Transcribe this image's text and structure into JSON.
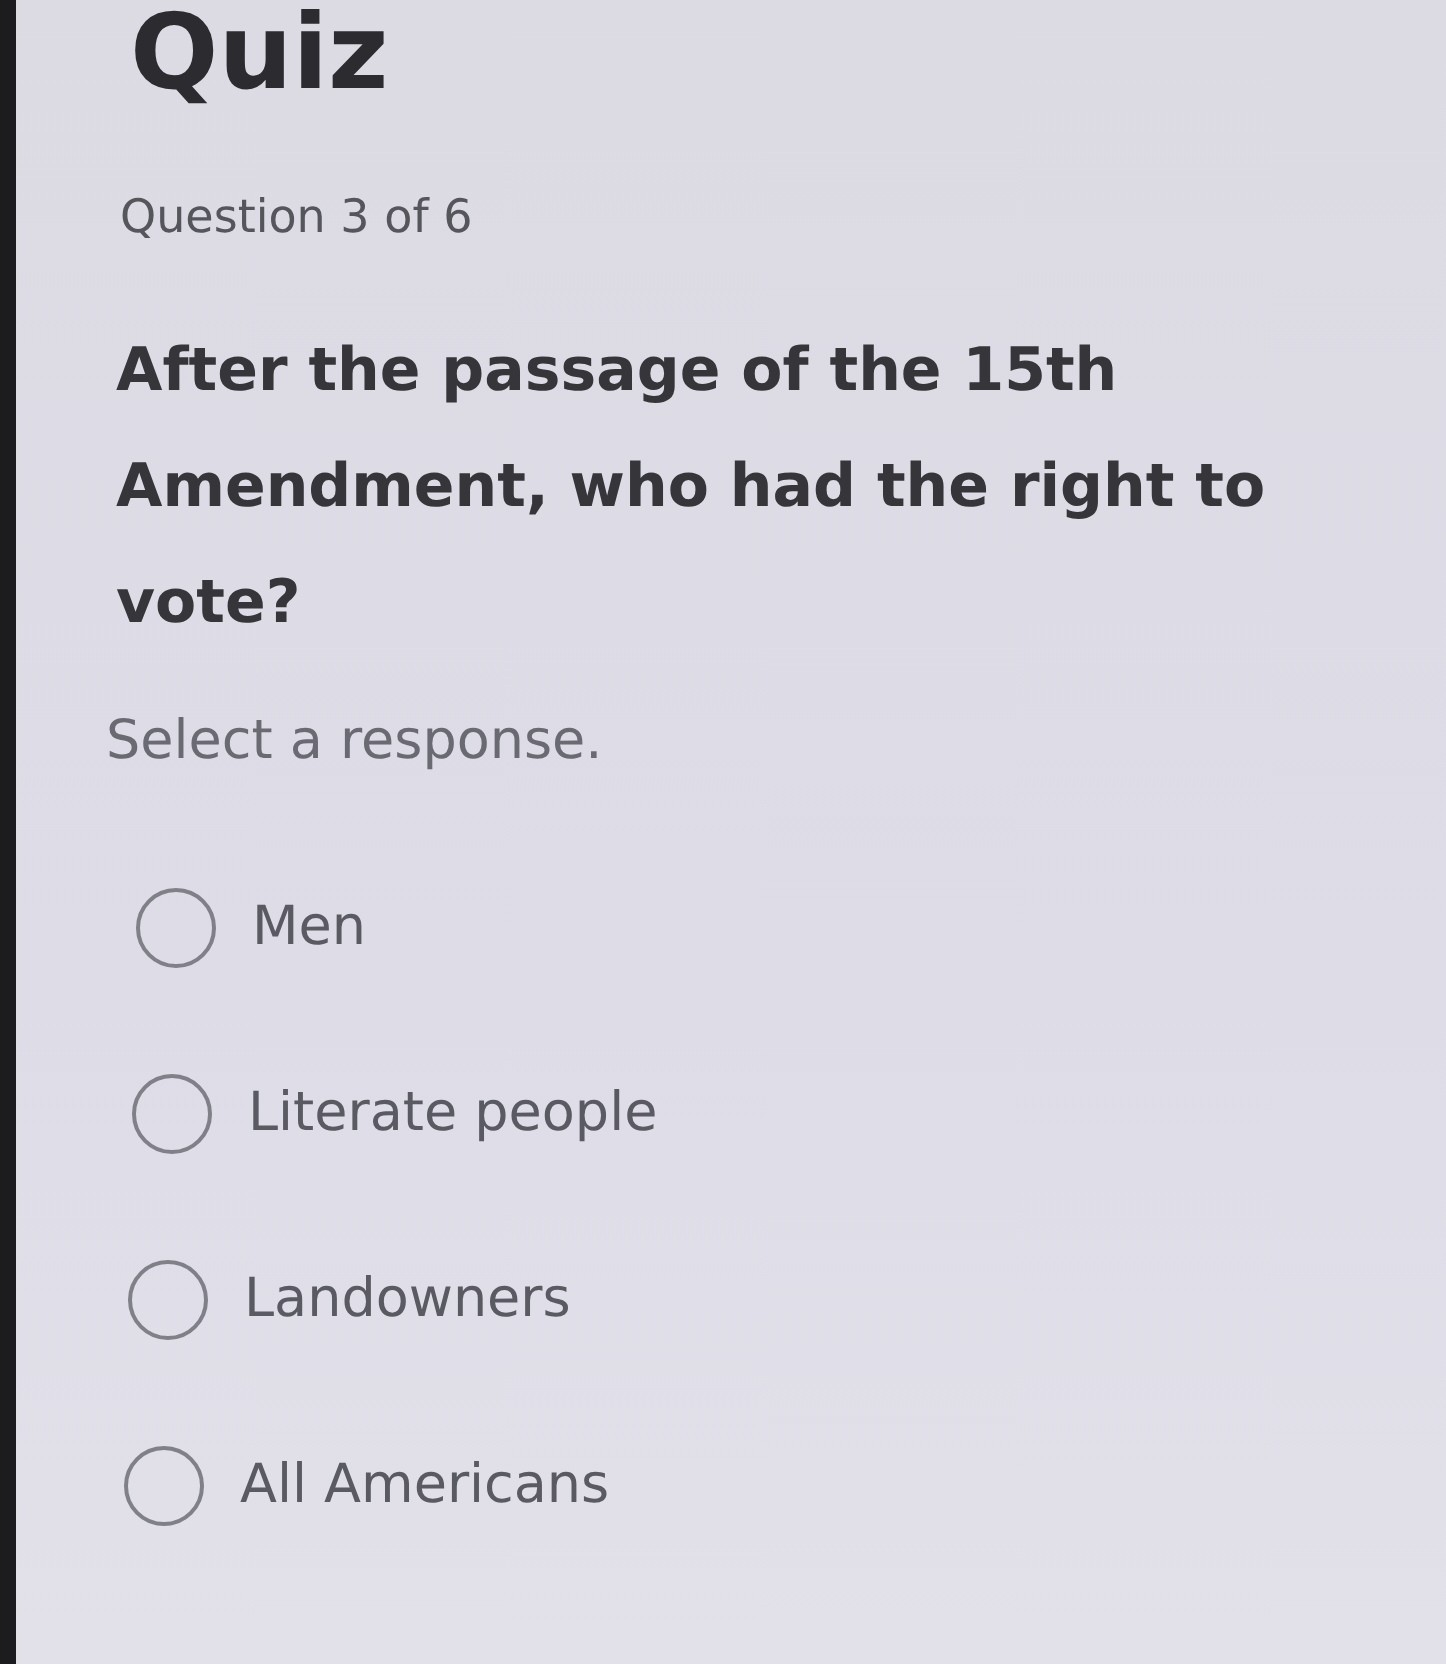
{
  "title": "Quiz",
  "progress": "Question 3 of 6",
  "question": "After the passage of the 15th Amendment, who had the right to vote?",
  "instruction": "Select a response.",
  "options": [
    {
      "label": "Men",
      "selected": false
    },
    {
      "label": "Literate people",
      "selected": false
    },
    {
      "label": "Landowners",
      "selected": false
    },
    {
      "label": "All Americans",
      "selected": false
    }
  ]
}
